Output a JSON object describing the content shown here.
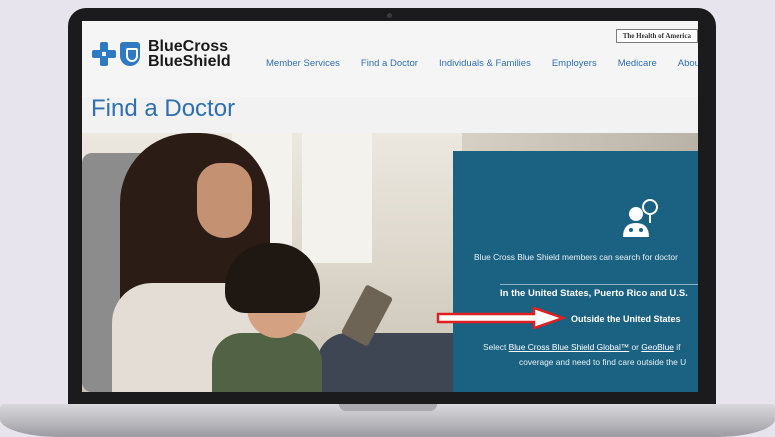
{
  "header": {
    "tagline": "The Health of America",
    "logo_line1": "BlueCross",
    "logo_line2": "BlueShield"
  },
  "nav": {
    "items": [
      "Member Services",
      "Find a Doctor",
      "Individuals & Families",
      "Employers",
      "Medicare",
      "About Us"
    ]
  },
  "page": {
    "title": "Find a Doctor"
  },
  "panel": {
    "intro": "Blue Cross Blue Shield members can search for doctor",
    "option_us": "In the United States, Puerto Rico and U.S.",
    "option_outside": "Outside the United States",
    "select_prefix": "Select ",
    "link_global": "Blue Cross Blue Shield Global™",
    "select_or": " or ",
    "link_geoblue": "GeoBlue",
    "select_suffix": " if",
    "coverage_line": "coverage and need to find care outside the U"
  },
  "colors": {
    "brand_blue": "#2f6fb0",
    "panel_teal": "#1b6282",
    "arrow_red": "#e02020"
  },
  "icons": [
    "doctor-search-icon",
    "cross-logo-icon",
    "shield-logo-icon"
  ]
}
